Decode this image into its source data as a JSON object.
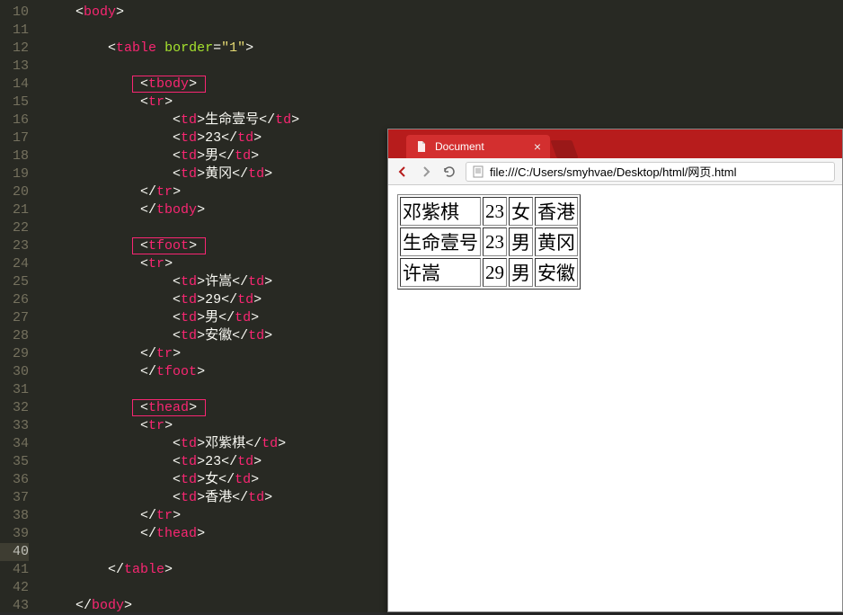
{
  "editor": {
    "lines": [
      {
        "n": 10,
        "indent": 1,
        "tokens": [
          {
            "t": "bracket",
            "v": "<"
          },
          {
            "t": "tag",
            "v": "body"
          },
          {
            "t": "bracket",
            "v": ">"
          }
        ]
      },
      {
        "n": 11,
        "indent": 0,
        "tokens": []
      },
      {
        "n": 12,
        "indent": 2,
        "tokens": [
          {
            "t": "bracket",
            "v": "<"
          },
          {
            "t": "tag",
            "v": "table"
          },
          {
            "t": "txt",
            "v": " "
          },
          {
            "t": "attr",
            "v": "border"
          },
          {
            "t": "bracket",
            "v": "="
          },
          {
            "t": "str",
            "v": "\"1\""
          },
          {
            "t": "bracket",
            "v": ">"
          }
        ]
      },
      {
        "n": 13,
        "indent": 0,
        "tokens": []
      },
      {
        "n": 14,
        "indent": 3,
        "tokens": [
          {
            "t": "bracket",
            "v": "<"
          },
          {
            "t": "tag",
            "v": "tbody"
          },
          {
            "t": "bracket",
            "v": ">"
          }
        ],
        "boxed": true,
        "boxw": 82
      },
      {
        "n": 15,
        "indent": 3,
        "tokens": [
          {
            "t": "bracket",
            "v": "<"
          },
          {
            "t": "tag",
            "v": "tr"
          },
          {
            "t": "bracket",
            "v": ">"
          }
        ]
      },
      {
        "n": 16,
        "indent": 4,
        "tokens": [
          {
            "t": "bracket",
            "v": "<"
          },
          {
            "t": "tag",
            "v": "td"
          },
          {
            "t": "bracket",
            "v": ">"
          },
          {
            "t": "txt",
            "v": "生命壹号"
          },
          {
            "t": "bracket",
            "v": "</"
          },
          {
            "t": "tag",
            "v": "td"
          },
          {
            "t": "bracket",
            "v": ">"
          }
        ]
      },
      {
        "n": 17,
        "indent": 4,
        "tokens": [
          {
            "t": "bracket",
            "v": "<"
          },
          {
            "t": "tag",
            "v": "td"
          },
          {
            "t": "bracket",
            "v": ">"
          },
          {
            "t": "txt",
            "v": "23"
          },
          {
            "t": "bracket",
            "v": "</"
          },
          {
            "t": "tag",
            "v": "td"
          },
          {
            "t": "bracket",
            "v": ">"
          }
        ]
      },
      {
        "n": 18,
        "indent": 4,
        "tokens": [
          {
            "t": "bracket",
            "v": "<"
          },
          {
            "t": "tag",
            "v": "td"
          },
          {
            "t": "bracket",
            "v": ">"
          },
          {
            "t": "txt",
            "v": "男"
          },
          {
            "t": "bracket",
            "v": "</"
          },
          {
            "t": "tag",
            "v": "td"
          },
          {
            "t": "bracket",
            "v": ">"
          }
        ]
      },
      {
        "n": 19,
        "indent": 4,
        "tokens": [
          {
            "t": "bracket",
            "v": "<"
          },
          {
            "t": "tag",
            "v": "td"
          },
          {
            "t": "bracket",
            "v": ">"
          },
          {
            "t": "txt",
            "v": "黄冈"
          },
          {
            "t": "bracket",
            "v": "</"
          },
          {
            "t": "tag",
            "v": "td"
          },
          {
            "t": "bracket",
            "v": ">"
          }
        ]
      },
      {
        "n": 20,
        "indent": 3,
        "tokens": [
          {
            "t": "bracket",
            "v": "</"
          },
          {
            "t": "tag",
            "v": "tr"
          },
          {
            "t": "bracket",
            "v": ">"
          }
        ]
      },
      {
        "n": 21,
        "indent": 3,
        "tokens": [
          {
            "t": "bracket",
            "v": "</"
          },
          {
            "t": "tag",
            "v": "tbody"
          },
          {
            "t": "bracket",
            "v": ">"
          }
        ]
      },
      {
        "n": 22,
        "indent": 0,
        "tokens": []
      },
      {
        "n": 23,
        "indent": 3,
        "tokens": [
          {
            "t": "bracket",
            "v": "<"
          },
          {
            "t": "tag",
            "v": "tfoot"
          },
          {
            "t": "bracket",
            "v": ">"
          }
        ],
        "boxed": true,
        "boxw": 82
      },
      {
        "n": 24,
        "indent": 3,
        "tokens": [
          {
            "t": "bracket",
            "v": "<"
          },
          {
            "t": "tag",
            "v": "tr"
          },
          {
            "t": "bracket",
            "v": ">"
          }
        ]
      },
      {
        "n": 25,
        "indent": 4,
        "tokens": [
          {
            "t": "bracket",
            "v": "<"
          },
          {
            "t": "tag",
            "v": "td"
          },
          {
            "t": "bracket",
            "v": ">"
          },
          {
            "t": "txt",
            "v": "许嵩"
          },
          {
            "t": "bracket",
            "v": "</"
          },
          {
            "t": "tag",
            "v": "td"
          },
          {
            "t": "bracket",
            "v": ">"
          }
        ]
      },
      {
        "n": 26,
        "indent": 4,
        "tokens": [
          {
            "t": "bracket",
            "v": "<"
          },
          {
            "t": "tag",
            "v": "td"
          },
          {
            "t": "bracket",
            "v": ">"
          },
          {
            "t": "txt",
            "v": "29"
          },
          {
            "t": "bracket",
            "v": "</"
          },
          {
            "t": "tag",
            "v": "td"
          },
          {
            "t": "bracket",
            "v": ">"
          }
        ]
      },
      {
        "n": 27,
        "indent": 4,
        "tokens": [
          {
            "t": "bracket",
            "v": "<"
          },
          {
            "t": "tag",
            "v": "td"
          },
          {
            "t": "bracket",
            "v": ">"
          },
          {
            "t": "txt",
            "v": "男"
          },
          {
            "t": "bracket",
            "v": "</"
          },
          {
            "t": "tag",
            "v": "td"
          },
          {
            "t": "bracket",
            "v": ">"
          }
        ]
      },
      {
        "n": 28,
        "indent": 4,
        "tokens": [
          {
            "t": "bracket",
            "v": "<"
          },
          {
            "t": "tag",
            "v": "td"
          },
          {
            "t": "bracket",
            "v": ">"
          },
          {
            "t": "txt",
            "v": "安徽"
          },
          {
            "t": "bracket",
            "v": "</"
          },
          {
            "t": "tag",
            "v": "td"
          },
          {
            "t": "bracket",
            "v": ">"
          }
        ]
      },
      {
        "n": 29,
        "indent": 3,
        "tokens": [
          {
            "t": "bracket",
            "v": "</"
          },
          {
            "t": "tag",
            "v": "tr"
          },
          {
            "t": "bracket",
            "v": ">"
          }
        ]
      },
      {
        "n": 30,
        "indent": 3,
        "tokens": [
          {
            "t": "bracket",
            "v": "</"
          },
          {
            "t": "tag",
            "v": "tfoot"
          },
          {
            "t": "bracket",
            "v": ">"
          }
        ]
      },
      {
        "n": 31,
        "indent": 0,
        "tokens": []
      },
      {
        "n": 32,
        "indent": 3,
        "tokens": [
          {
            "t": "bracket",
            "v": "<"
          },
          {
            "t": "tag",
            "v": "thead"
          },
          {
            "t": "bracket",
            "v": ">"
          }
        ],
        "boxed": true,
        "boxw": 82
      },
      {
        "n": 33,
        "indent": 3,
        "tokens": [
          {
            "t": "bracket",
            "v": "<"
          },
          {
            "t": "tag",
            "v": "tr"
          },
          {
            "t": "bracket",
            "v": ">"
          }
        ]
      },
      {
        "n": 34,
        "indent": 4,
        "tokens": [
          {
            "t": "bracket",
            "v": "<"
          },
          {
            "t": "tag",
            "v": "td"
          },
          {
            "t": "bracket",
            "v": ">"
          },
          {
            "t": "txt",
            "v": "邓紫棋"
          },
          {
            "t": "bracket",
            "v": "</"
          },
          {
            "t": "tag",
            "v": "td"
          },
          {
            "t": "bracket",
            "v": ">"
          }
        ]
      },
      {
        "n": 35,
        "indent": 4,
        "tokens": [
          {
            "t": "bracket",
            "v": "<"
          },
          {
            "t": "tag",
            "v": "td"
          },
          {
            "t": "bracket",
            "v": ">"
          },
          {
            "t": "txt",
            "v": "23"
          },
          {
            "t": "bracket",
            "v": "</"
          },
          {
            "t": "tag",
            "v": "td"
          },
          {
            "t": "bracket",
            "v": ">"
          }
        ]
      },
      {
        "n": 36,
        "indent": 4,
        "tokens": [
          {
            "t": "bracket",
            "v": "<"
          },
          {
            "t": "tag",
            "v": "td"
          },
          {
            "t": "bracket",
            "v": ">"
          },
          {
            "t": "txt",
            "v": "女"
          },
          {
            "t": "bracket",
            "v": "</"
          },
          {
            "t": "tag",
            "v": "td"
          },
          {
            "t": "bracket",
            "v": ">"
          }
        ]
      },
      {
        "n": 37,
        "indent": 4,
        "tokens": [
          {
            "t": "bracket",
            "v": "<"
          },
          {
            "t": "tag",
            "v": "td"
          },
          {
            "t": "bracket",
            "v": ">"
          },
          {
            "t": "txt",
            "v": "香港"
          },
          {
            "t": "bracket",
            "v": "</"
          },
          {
            "t": "tag",
            "v": "td"
          },
          {
            "t": "bracket",
            "v": ">"
          }
        ]
      },
      {
        "n": 38,
        "indent": 3,
        "tokens": [
          {
            "t": "bracket",
            "v": "</"
          },
          {
            "t": "tag",
            "v": "tr"
          },
          {
            "t": "bracket",
            "v": ">"
          }
        ]
      },
      {
        "n": 39,
        "indent": 3,
        "tokens": [
          {
            "t": "bracket",
            "v": "</"
          },
          {
            "t": "tag",
            "v": "thead"
          },
          {
            "t": "bracket",
            "v": ">"
          }
        ]
      },
      {
        "n": 40,
        "indent": 0,
        "tokens": [],
        "hl": true
      },
      {
        "n": 41,
        "indent": 2,
        "tokens": [
          {
            "t": "bracket",
            "v": "</"
          },
          {
            "t": "tag",
            "v": "table"
          },
          {
            "t": "bracket",
            "v": ">"
          }
        ]
      },
      {
        "n": 42,
        "indent": 0,
        "tokens": []
      },
      {
        "n": 43,
        "indent": 1,
        "tokens": [
          {
            "t": "bracket",
            "v": "</"
          },
          {
            "t": "tag",
            "v": "body"
          },
          {
            "t": "bracket",
            "v": ">"
          }
        ]
      }
    ]
  },
  "browser": {
    "tab_title": "Document",
    "url": "file:///C:/Users/smyhvae/Desktop/html/网页.html",
    "table": [
      [
        "邓紫棋",
        "23",
        "女",
        "香港"
      ],
      [
        "生命壹号",
        "23",
        "男",
        "黄冈"
      ],
      [
        "许嵩",
        "29",
        "男",
        "安徽"
      ]
    ]
  }
}
